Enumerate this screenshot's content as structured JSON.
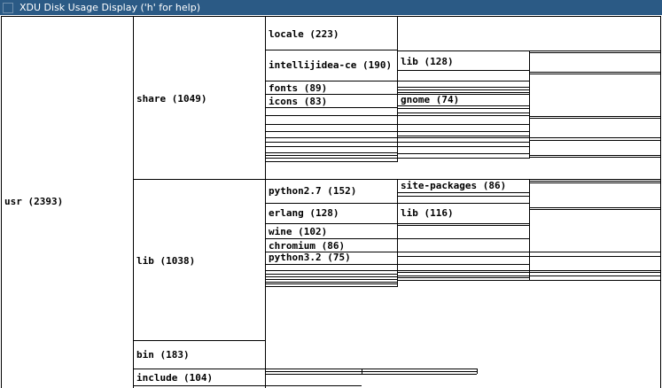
{
  "window": {
    "title": "XDU Disk Usage Display ('h' for help)"
  },
  "tree": {
    "usr": "usr (2393)",
    "share": "share (1049)",
    "lib": "lib (1038)",
    "bin": "bin (183)",
    "include": "include (104)",
    "share_children": {
      "locale": "locale (223)",
      "intellijidea": "intellijidea-ce (190)",
      "fonts": "fonts (89)",
      "icons": "icons (83)",
      "intellijidea_lib": "lib (128)",
      "icons_gnome": "gnome (74)"
    },
    "lib_children": {
      "python27": "python2.7 (152)",
      "erlang": "erlang (128)",
      "wine": "wine (102)",
      "chromium": "chromium (86)",
      "python32": "python3.2 (75)",
      "site_packages": "site-packages (86)",
      "erlang_lib": "lib (116)"
    }
  }
}
